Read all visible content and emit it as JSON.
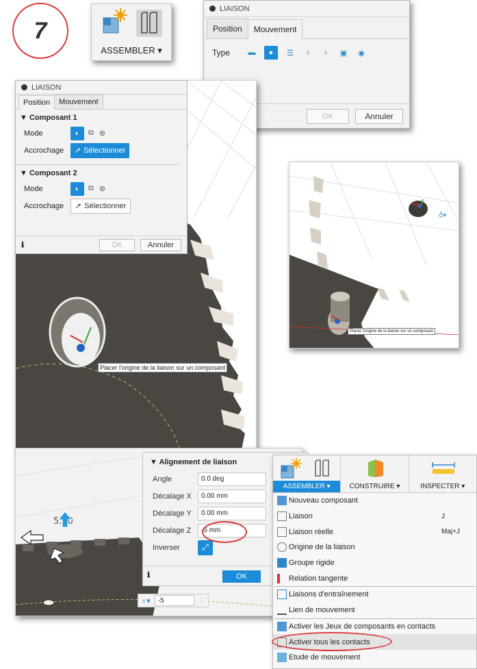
{
  "step_number": "7",
  "top_toolbar": {
    "label": "ASSEMBLER ▾"
  },
  "motion_dialog": {
    "title": "LIAISON",
    "tabs": [
      "Position",
      "Mouvement"
    ],
    "type_label": "Type",
    "ok": "OK",
    "cancel": "Annuler"
  },
  "position_dialog": {
    "title": "LIAISON",
    "tabs": [
      "Position",
      "Mouvement"
    ],
    "component1": "▼ Composant 1",
    "component2": "▼ Composant 2",
    "mode_label": "Mode",
    "snap_label": "Accrochage",
    "select_label": "Sélectionner",
    "ok": "OK",
    "cancel": "Annuler"
  },
  "tooltip_main": "Placer l'origine de la liaison sur un composant",
  "tooltip_small": "Placer l'origine de la liaison sur un composant",
  "alignment_panel": {
    "header": "▼ Alignement de liaison",
    "rows": [
      {
        "label": "Angle",
        "value": "0.0 deg"
      },
      {
        "label": "Décalage X",
        "value": "0.00 mm"
      },
      {
        "label": "Décalage Y",
        "value": "0.00 mm"
      },
      {
        "label": "Décalage Z",
        "value": "-5 mm"
      }
    ],
    "flip_label": "Inverser",
    "ok": "OK"
  },
  "scene_bottom": {
    "dimension": "5.00",
    "input_value": "-5"
  },
  "menu": {
    "toolbar": {
      "assembler": "ASSEMBLER ▾",
      "construire": "CONSTRUIRE ▾",
      "inspecter": "INSPECTER ▾"
    },
    "items": [
      {
        "label": "Nouveau composant",
        "shortcut": ""
      },
      {
        "label": "Liaison",
        "shortcut": "J"
      },
      {
        "label": "Liaison réelle",
        "shortcut": "Maj+J"
      },
      {
        "label": "Origine de la liaison",
        "shortcut": ""
      },
      {
        "label": "Groupe rigide",
        "shortcut": ""
      },
      {
        "label": "Relation tangente",
        "shortcut": ""
      },
      {
        "label": "Liaisons d'entraînement",
        "shortcut": ""
      },
      {
        "label": "Lien de mouvement",
        "shortcut": ""
      },
      {
        "label": "Activer les Jeux de composants en contacts",
        "shortcut": ""
      },
      {
        "label": "Activer tous les contacts",
        "shortcut": ""
      },
      {
        "label": "Etude de mouvement",
        "shortcut": ""
      }
    ]
  },
  "colors": {
    "accent": "#1c8bd8",
    "highlight_circle": "#d9383a",
    "gear": "#4a4743"
  }
}
